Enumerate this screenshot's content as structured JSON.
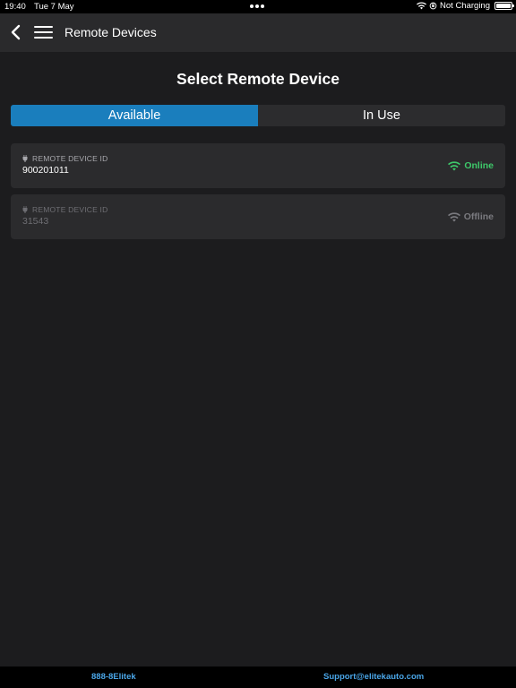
{
  "status_bar": {
    "time": "19:40",
    "date": "Tue 7 May",
    "charging": "Not Charging"
  },
  "nav": {
    "title": "Remote Devices"
  },
  "page": {
    "title": "Select Remote Device"
  },
  "tabs": [
    {
      "label": "Available",
      "active": true
    },
    {
      "label": "In Use",
      "active": false
    }
  ],
  "devices": [
    {
      "label": "REMOTE DEVICE ID",
      "id": "900201011",
      "status": "Online"
    },
    {
      "label": "REMOTE DEVICE ID",
      "id": "31543",
      "status": "Offline"
    }
  ],
  "footer": {
    "phone": "888-8Elitek",
    "email": "Support@elitekauto.com"
  },
  "colors": {
    "accent": "#1a7ebd",
    "online": "#3ec86a",
    "offline": "#7a7a7f",
    "link": "#4aa6e8"
  },
  "icons": [
    "back-chevron-icon",
    "hamburger-menu-icon",
    "plug-icon",
    "wifi-icon",
    "battery-icon"
  ]
}
